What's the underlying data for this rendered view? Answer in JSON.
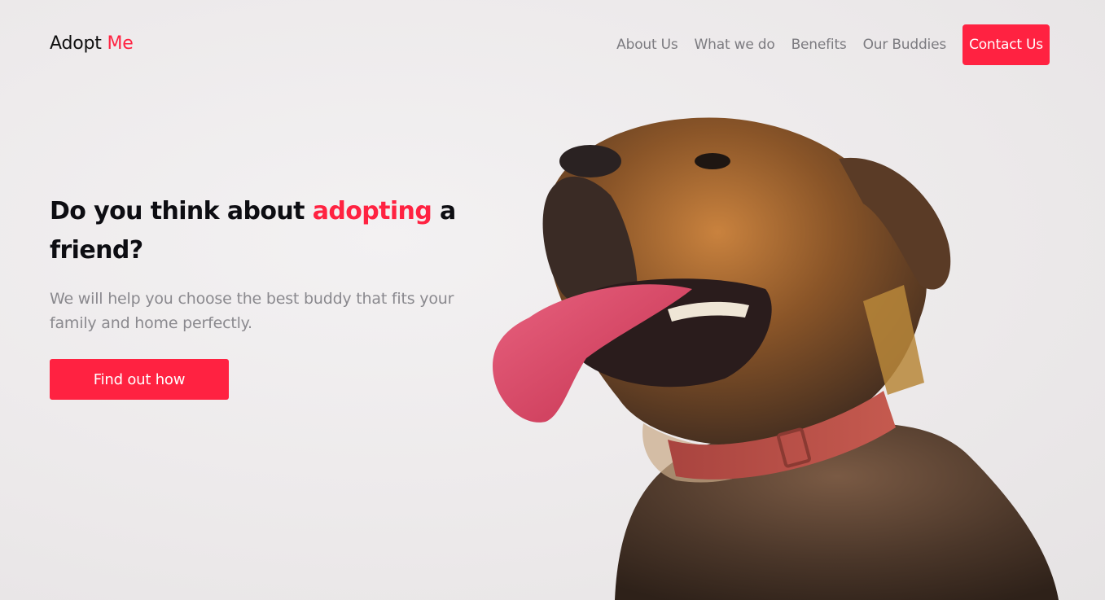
{
  "logo": {
    "text_main": "Adopt",
    "text_accent": "Me"
  },
  "nav": {
    "items": [
      "About Us",
      "What we do",
      "Benefits",
      "Our Buddies"
    ],
    "cta_label": "Contact Us"
  },
  "hero": {
    "title_before": "Do you think about ",
    "title_accent": "adopting",
    "title_after": " a friend?",
    "subtitle": "We will help you choose the best buddy that fits your family and home perfectly.",
    "button_label": "Find out how"
  },
  "colors": {
    "accent": "#ff2241",
    "text_dark": "#0d0d12",
    "text_muted": "#8a898e",
    "background": "#eeeced"
  }
}
